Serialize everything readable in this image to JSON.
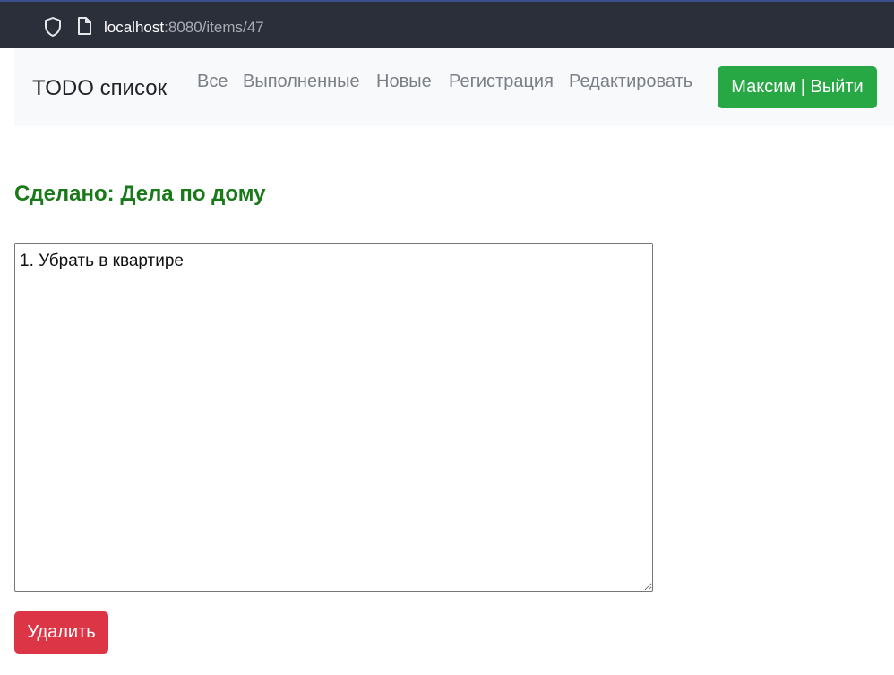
{
  "browser": {
    "url_host": "localhost",
    "url_rest": ":8080/items/47",
    "icons": [
      "shield-icon",
      "page-icon"
    ]
  },
  "navbar": {
    "brand": "TODO список",
    "links": [
      {
        "label": "Все"
      },
      {
        "label": "Выполненные"
      },
      {
        "label": "Новые"
      },
      {
        "label": "Регистрация"
      },
      {
        "label": "Редактировать"
      }
    ],
    "user_button_label": "Максим | Выйти"
  },
  "item": {
    "title": "Сделано: Дела по дому",
    "description": "1. Убрать в квартире",
    "delete_label": "Удалить"
  },
  "colors": {
    "browser_bar": "#2b2f3a",
    "navbar_bg": "#f8f9fa",
    "success": "#28a745",
    "danger": "#dc3545",
    "title_green": "#1a7a1a"
  }
}
